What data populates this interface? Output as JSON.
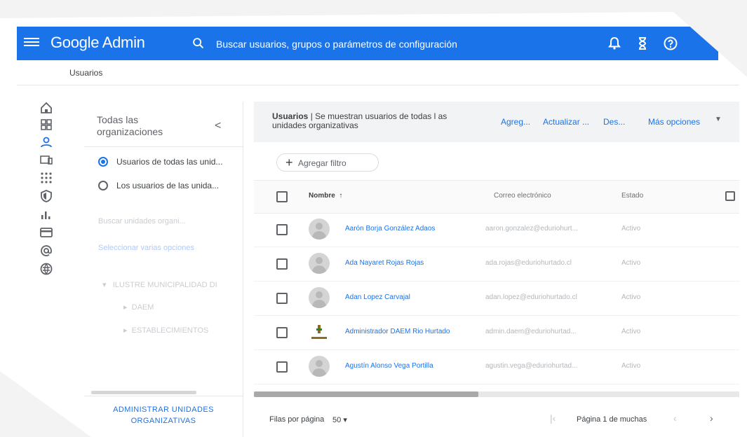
{
  "header": {
    "brand": "Google Admin",
    "search_placeholder": "Buscar usuarios, grupos o parámetros de configuración",
    "icons": [
      "menu-icon",
      "search-icon",
      "bell-icon",
      "hourglass-icon",
      "help-icon"
    ],
    "color": "#1a73e8"
  },
  "breadcrumb": "Usuarios",
  "rail": {
    "icons": [
      "home-icon",
      "dashboard-icon",
      "users-icon",
      "devices-icon",
      "apps-icon",
      "security-icon",
      "reports-icon",
      "billing-icon",
      "account-icon",
      "domains-icon"
    ]
  },
  "org_panel": {
    "title": "Todas las organizaciones",
    "collapse": "<",
    "options": [
      {
        "label": "Usuarios de todas las unid...",
        "selected": true
      },
      {
        "label": "Los usuarios de las unida...",
        "selected": false
      }
    ],
    "faded_items": [
      "Buscar unidades organi...",
      "Seleccionar varias opciones",
      "ILUSTRE MUNICIPALIDAD DI",
      "DAEM",
      "ESTABLECIMIENTOS"
    ],
    "manage_link": "ADMINISTRAR UNIDADES ORGANIZATIVAS"
  },
  "users_panel": {
    "title_bold": "Usuarios",
    "title_rest": " | Se muestran usuarios de todas l as unidades organizativas",
    "actions": [
      "Agreg...",
      "Actualizar ...",
      "Des...",
      "Más opciones"
    ],
    "add_filter": "Agregar filtro",
    "columns": {
      "name": "Nombre",
      "sort_arrow": "↑",
      "email": "Correo electrónico",
      "status": "Estado"
    },
    "rows": [
      {
        "name": "Aarón Borja González Adaos",
        "email": "aaron.gonzalez@eduriohurt...",
        "status": "Activo",
        "avatar": "default"
      },
      {
        "name": "Ada Nayaret Rojas Rojas",
        "email": "ada.rojas@eduriohurtado.cl",
        "status": "Activo",
        "avatar": "default"
      },
      {
        "name": "Adan Lopez Carvajal",
        "email": "adan.lopez@eduriohurtado.cl",
        "status": "Activo",
        "avatar": "default"
      },
      {
        "name": "Administrador DAEM Rio Hurtado",
        "email": "admin.daem@eduriohurtad...",
        "status": "Activo",
        "avatar": "logo"
      },
      {
        "name": "Agustín Alonso Vega Portilla",
        "email": "agustin.vega@eduriohurtad...",
        "status": "Activo",
        "avatar": "default"
      }
    ],
    "footer": {
      "rows_per_page_label": "Filas por página",
      "rows_per_page_value": "50",
      "dropdown": "▾",
      "page_text": "Página 1 de muchas",
      "first": "|‹",
      "prev": "‹",
      "next": "›"
    }
  }
}
